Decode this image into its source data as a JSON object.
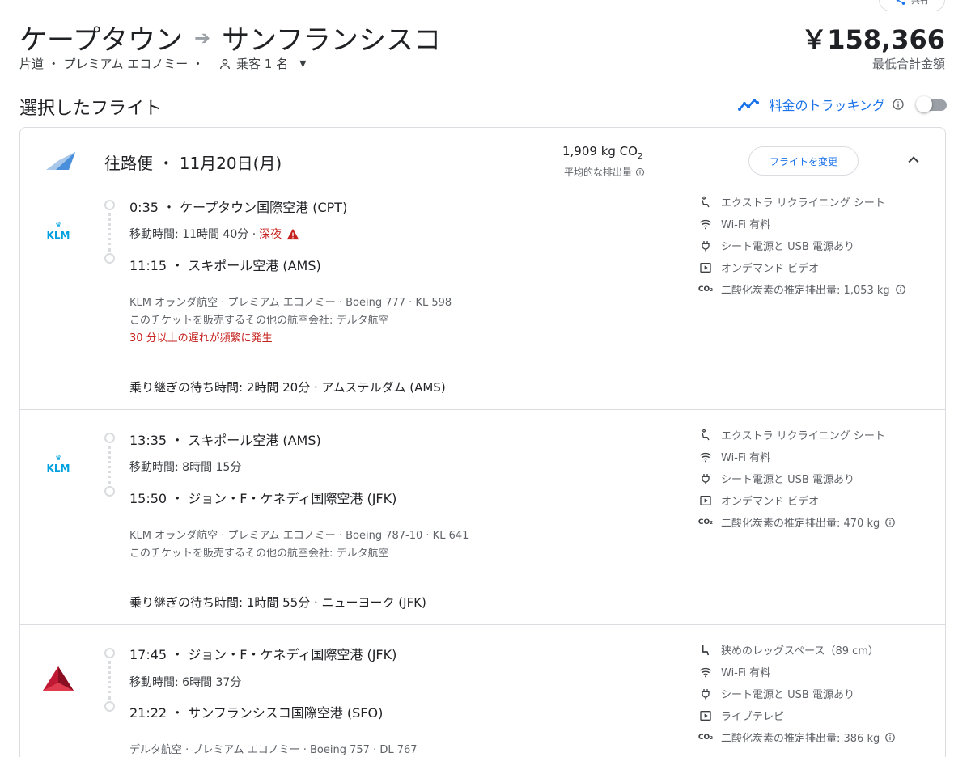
{
  "header": {
    "share_label": "共有",
    "origin": "ケープタウン",
    "destination": "サンフランシスコ",
    "trip_meta": "片道 ・ プレミアム エコノミー ・",
    "passengers": "乗客 1 名",
    "price": "￥158,366",
    "price_label": "最低合計金額"
  },
  "selected": {
    "heading": "選択したフライト",
    "tracking_label": "料金のトラッキング",
    "tracking_enabled": false
  },
  "card": {
    "title": "往路便 ・ 11月20日(月)",
    "co2_value": "1,909 kg CO",
    "co2_sub": "2",
    "co2_avg": "平均的な排出量",
    "change_button": "フライトを変更"
  },
  "segments": [
    {
      "airline_logo": "KLM",
      "depart": "0:35 ・ ケープタウン国際空港 (CPT)",
      "duration": "移動時間: 11時間 40分 ·",
      "night": "深夜",
      "arrive": "11:15 ・ スキポール空港 (AMS)",
      "detail1": "KLM オランダ航空 · プレミアム エコノミー · Boeing 777 · KL 598",
      "detail2": "このチケットを販売するその他の航空会社: デルタ航空",
      "delay": "30 分以上の遅れが頻繁に発生",
      "amenities": [
        "エクストラ リクライニング シート",
        "Wi-Fi 有料",
        "シート電源と USB 電源あり",
        "オンデマンド ビデオ",
        "二酸化炭素の推定排出量: 1,053 kg"
      ]
    },
    {
      "airline_logo": "KLM",
      "depart": "13:35 ・ スキポール空港 (AMS)",
      "duration": "移動時間: 8時間 15分",
      "arrive": "15:50 ・ ジョン・F・ケネディ国際空港 (JFK)",
      "detail1": "KLM オランダ航空 · プレミアム エコノミー · Boeing 787-10 · KL 641",
      "detail2": "このチケットを販売するその他の航空会社: デルタ航空",
      "amenities": [
        "エクストラ リクライニング シート",
        "Wi-Fi 有料",
        "シート電源と USB 電源あり",
        "オンデマンド ビデオ",
        "二酸化炭素の推定排出量: 470 kg"
      ]
    },
    {
      "airline_logo": "DELTA",
      "depart": "17:45 ・ ジョン・F・ケネディ国際空港 (JFK)",
      "duration": "移動時間: 6時間 37分",
      "arrive": "21:22 ・ サンフランシスコ国際空港 (SFO)",
      "detail1": "デルタ航空 · プレミアム エコノミー · Boeing 757 · DL 767",
      "amenities": [
        "狭めのレッグスペース（89 cm）",
        "Wi-Fi 有料",
        "シート電源と USB 電源あり",
        "ライブテレビ",
        "二酸化炭素の推定排出量: 386 kg"
      ]
    }
  ],
  "layovers": [
    "乗り継ぎの待ち時間: 2時間 20分 · アムステルダム (AMS)",
    "乗り継ぎの待ち時間: 1時間 55分 · ニューヨーク (JFK)"
  ],
  "icons": {
    "co2": "CO₂",
    "klm_crown": "♛"
  },
  "colors": {
    "accent": "#1a73e8",
    "warning": "#c5221f",
    "klm": "#00a1de",
    "delta": "#c01933"
  }
}
